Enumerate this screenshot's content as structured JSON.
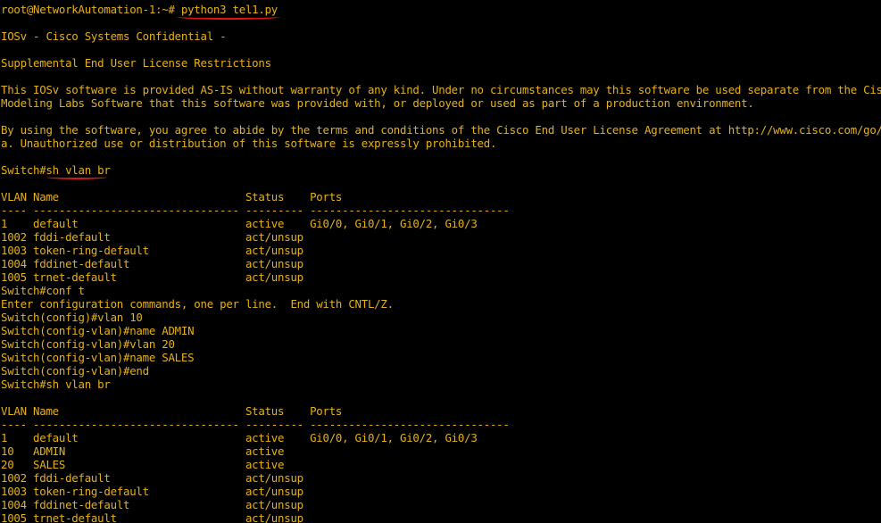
{
  "terminal": {
    "lines": [
      "root@NetworkAutomation-1:~# python3 tel1.py",
      "",
      "IOSv - Cisco Systems Confidential -",
      "",
      "Supplemental End User License Restrictions",
      "",
      "This IOSv software is provided AS-IS without warranty of any kind. Under no circumstances may this software be used separate from the Cisco",
      "Modeling Labs Software that this software was provided with, or deployed or used as part of a production environment.",
      "",
      "By using the software, you agree to abide by the terms and conditions of the Cisco End User License Agreement at http://www.cisco.com/go/eul",
      "a. Unauthorized use or distribution of this software is expressly prohibited.",
      "",
      "Switch#sh vlan br",
      "",
      "VLAN Name                             Status    Ports",
      "---- -------------------------------- --------- -------------------------------",
      "1    default                          active    Gi0/0, Gi0/1, Gi0/2, Gi0/3",
      "1002 fddi-default                     act/unsup",
      "1003 token-ring-default               act/unsup",
      "1004 fddinet-default                  act/unsup",
      "1005 trnet-default                    act/unsup",
      "Switch#conf t",
      "Enter configuration commands, one per line.  End with CNTL/Z.",
      "Switch(config)#vlan 10",
      "Switch(config-vlan)#name ADMIN",
      "Switch(config-vlan)#vlan 20",
      "Switch(config-vlan)#name SALES",
      "Switch(config-vlan)#end",
      "Switch#sh vlan br",
      "",
      "VLAN Name                             Status    Ports",
      "---- -------------------------------- --------- -------------------------------",
      "1    default                          active    Gi0/0, Gi0/1, Gi0/2, Gi0/3",
      "10   ADMIN                            active",
      "20   SALES                            active",
      "1002 fddi-default                     act/unsup",
      "1003 token-ring-default               act/unsup",
      "1004 fddinet-default                  act/unsup",
      "1005 trnet-default                    act/unsup"
    ]
  },
  "colors": {
    "background": "#000000",
    "text": "#e5b21a",
    "annotation": "#e01414"
  }
}
